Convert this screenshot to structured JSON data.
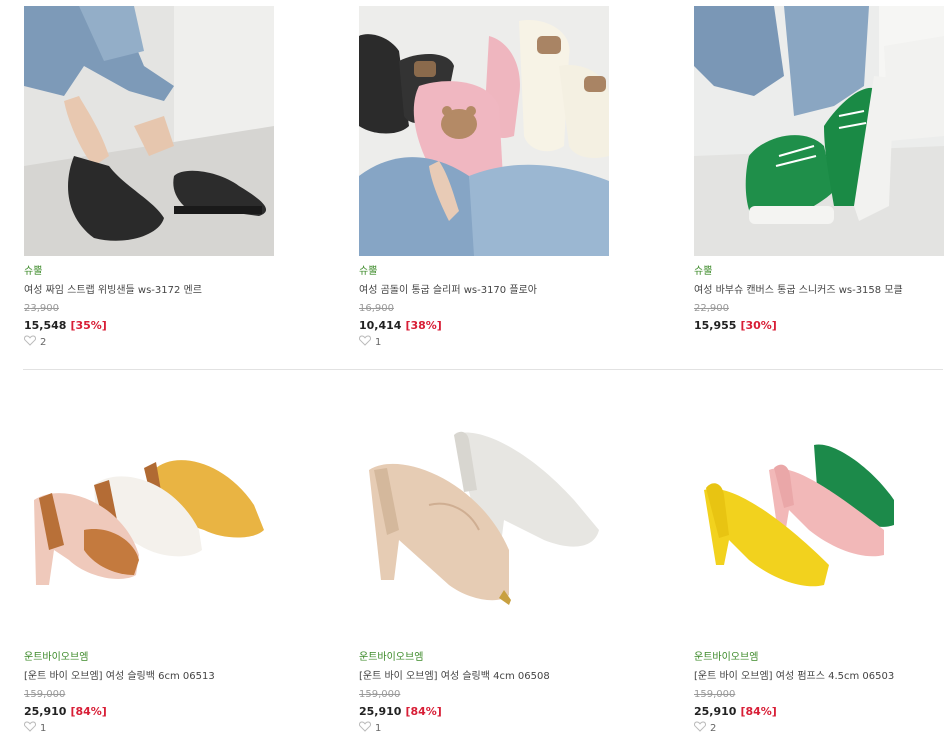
{
  "products": [
    {
      "brand": "슈뿔",
      "name": "여성 짜임 스트랩 위빙샌들 ws-3172 멘르",
      "original_price": "23,900",
      "sale_price": "15,548",
      "discount": "[35%]",
      "likes": "2"
    },
    {
      "brand": "슈뿔",
      "name": "여성 곰돌이 통굽 슬리퍼 ws-3170 플로아",
      "original_price": "16,900",
      "sale_price": "10,414",
      "discount": "[38%]",
      "likes": "1"
    },
    {
      "brand": "슈뿔",
      "name": "여성 바부슈 캔버스 통굽 스니커즈 ws-3158 모클",
      "original_price": "22,900",
      "sale_price": "15,955",
      "discount": "[30%]",
      "likes": ""
    },
    {
      "brand": "운트바이오브엠",
      "name": "[운트 바이 오브엠] 여성 슬링백 6cm 06513",
      "original_price": "159,000",
      "sale_price": "25,910",
      "discount": "[84%]",
      "likes": "1"
    },
    {
      "brand": "운트바이오브엠",
      "name": "[운트 바이 오브엠] 여성 슬링백 4cm 06508",
      "original_price": "159,000",
      "sale_price": "25,910",
      "discount": "[84%]",
      "likes": "1"
    },
    {
      "brand": "운트바이오브엠",
      "name": "[운트 바이 오브엠] 여성 펌프스 4.5cm 06503",
      "original_price": "159,000",
      "sale_price": "25,910",
      "discount": "[84%]",
      "likes": "2"
    }
  ],
  "colors": {
    "brand": "#3d8b2a",
    "discount": "#d81e36",
    "price": "#222222",
    "original_price": "#9a9a9a"
  },
  "icons": {
    "likes": "heart-outline-icon"
  }
}
